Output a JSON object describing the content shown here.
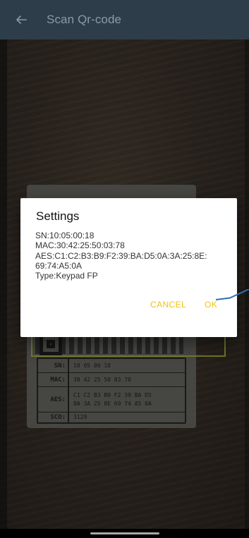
{
  "app_bar": {
    "title": "Scan Qr-code",
    "back_icon": "arrow-left-icon",
    "background": "#2e3d4a"
  },
  "camera_preview": {
    "label_rows": [
      {
        "key": "SN:",
        "value": "10 05 00 18"
      },
      {
        "key": "MAC:",
        "value": "30 42 25 50 03 78"
      },
      {
        "key": "AES:",
        "value": "C1 C2 B3 B9 F2 39 BA D5\n0A 3A 25 8E 69 74 A5 0A"
      },
      {
        "key": "SCO:",
        "value": "3129"
      }
    ]
  },
  "dialog": {
    "title": "Settings",
    "lines": [
      "SN:10:05:00:18",
      "MAC:30:42:25:50:03:78",
      "AES:C1:C2:B3:B9:F2:39:BA:D5:0A:3A:25:8E:",
      "69:74:A5:0A",
      "Type:Keypad FP"
    ],
    "cancel_label": "CANCEL",
    "ok_label": "OK",
    "button_color": "#f2c40b"
  },
  "annotation": {
    "line_color": "#2f6fb3"
  }
}
